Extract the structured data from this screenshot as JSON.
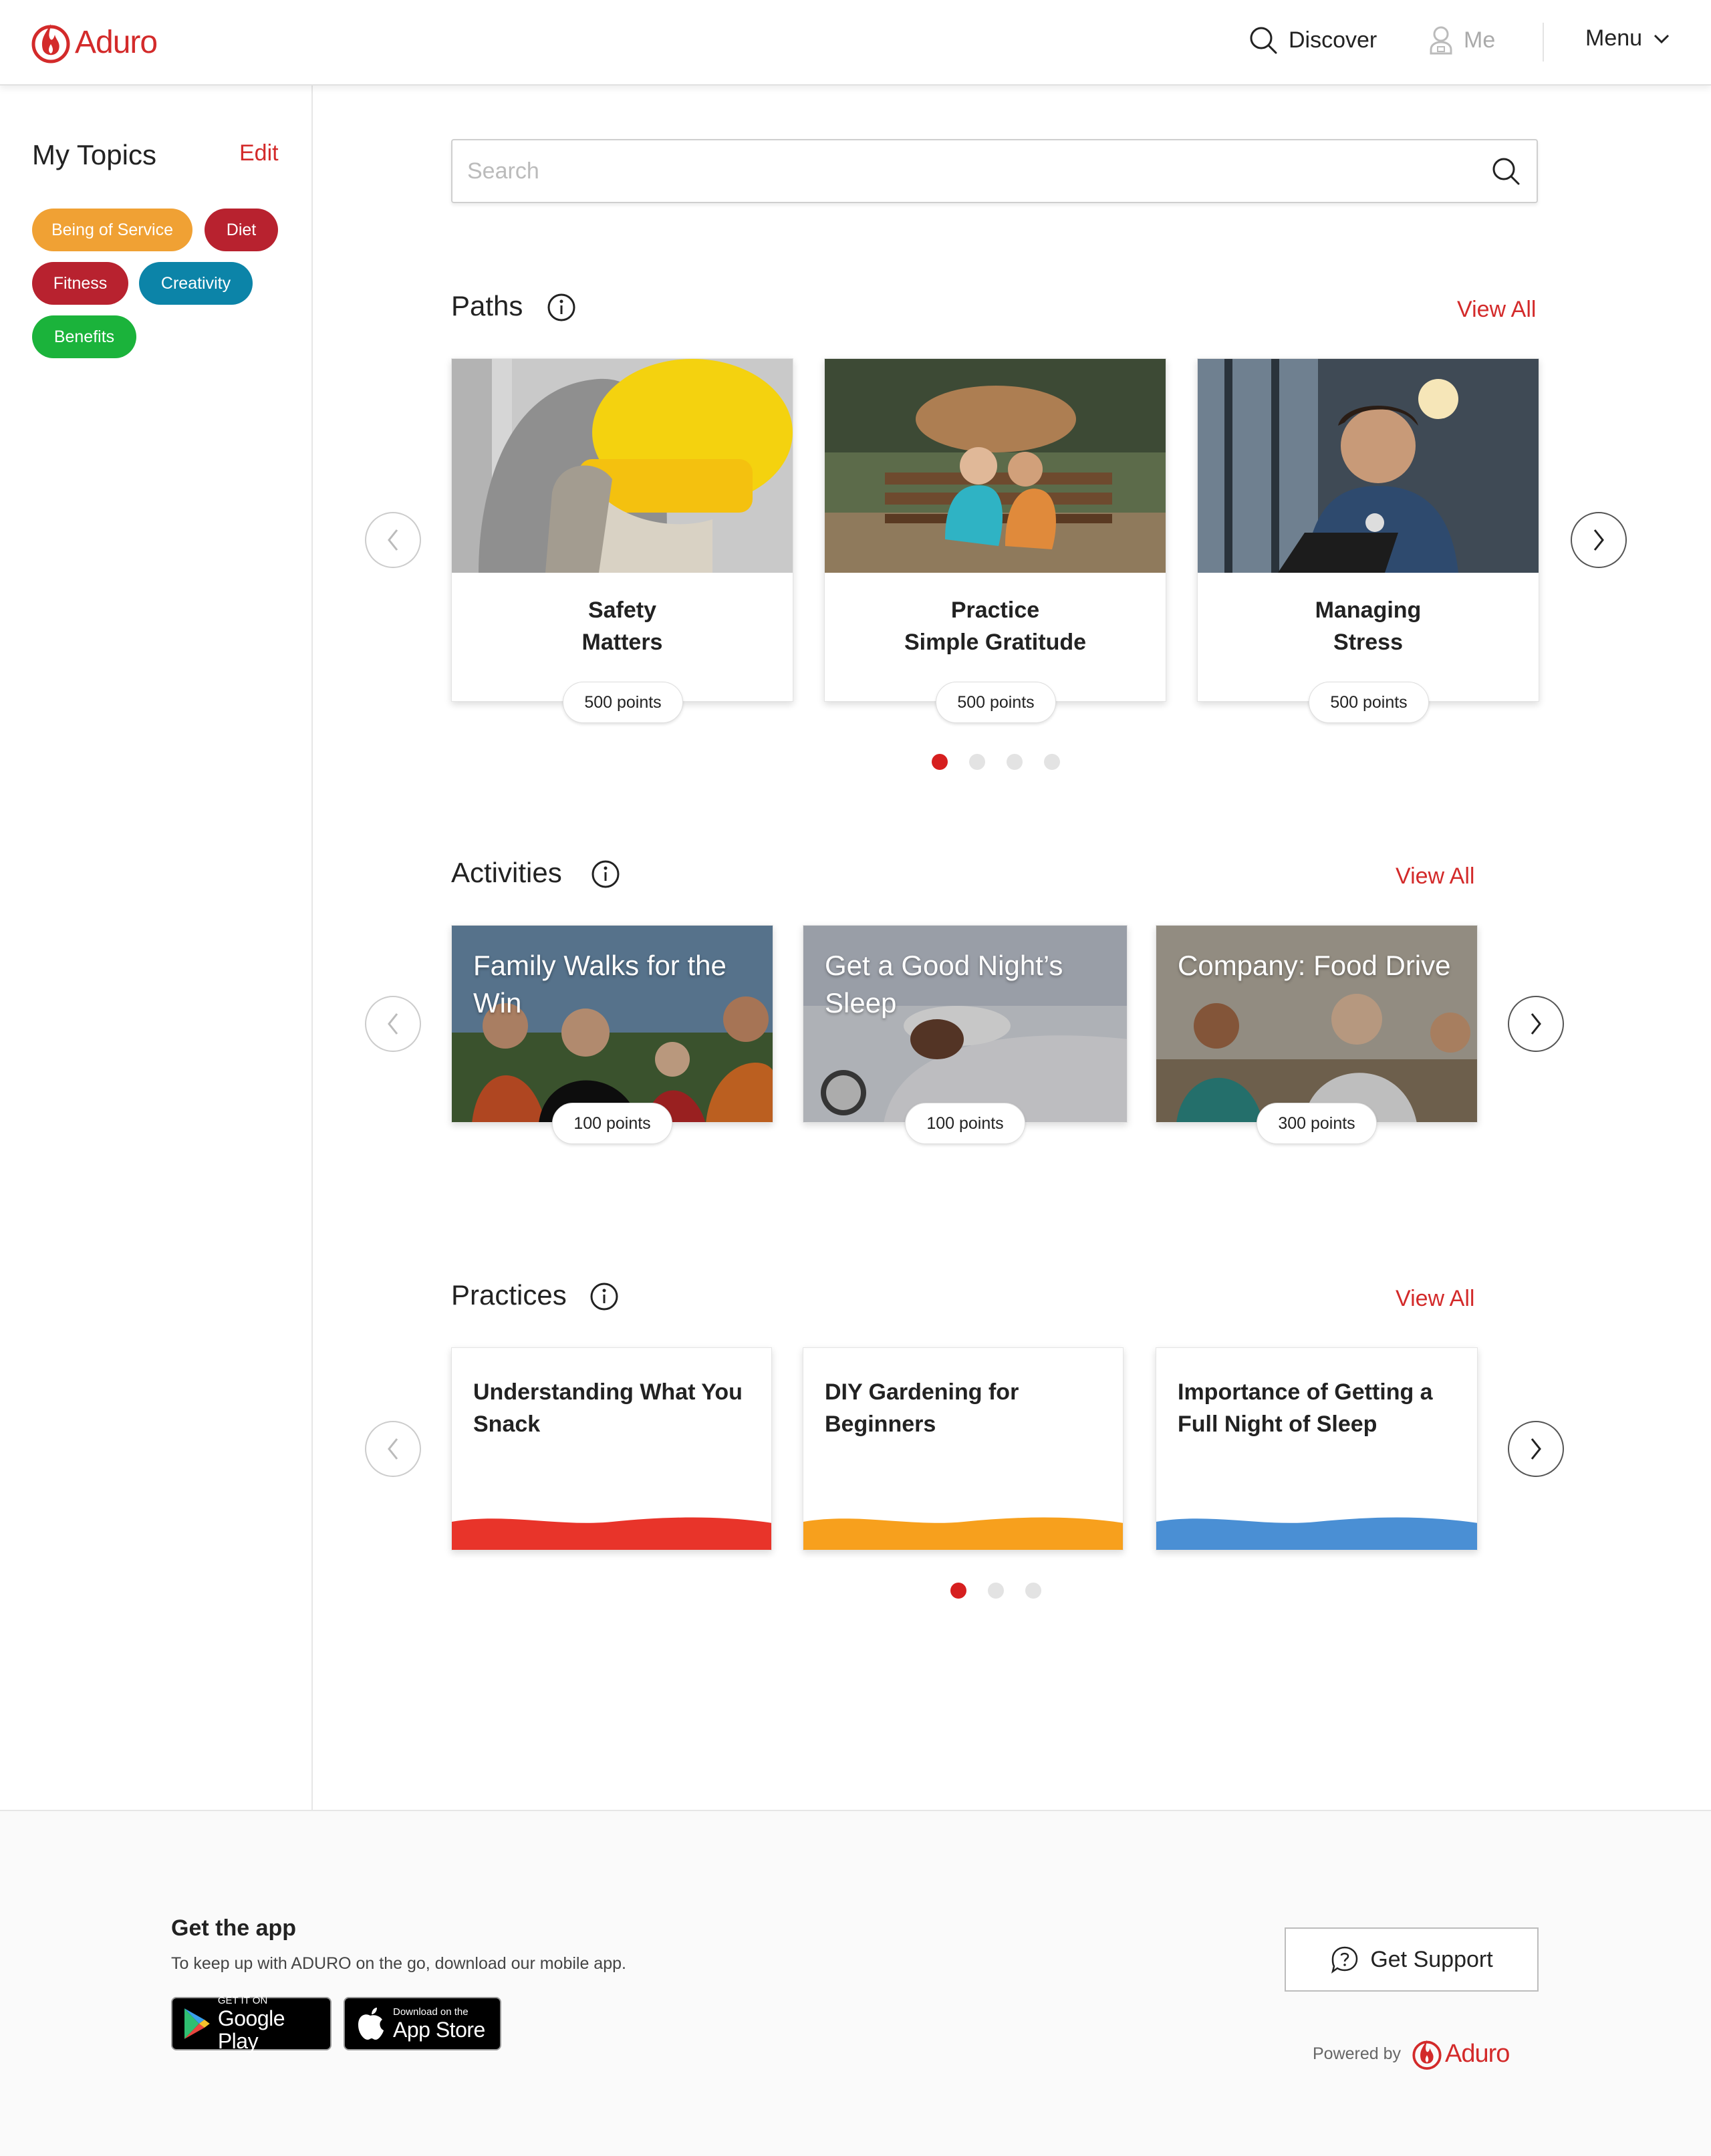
{
  "header": {
    "brand": "Aduro",
    "nav": {
      "discover": "Discover",
      "me": "Me",
      "menu": "Menu"
    }
  },
  "sidebar": {
    "title": "My Topics",
    "edit_label": "Edit",
    "topics": [
      {
        "label": "Being of Service",
        "color": "#f0a134"
      },
      {
        "label": "Diet",
        "color": "#b8222f"
      },
      {
        "label": "Fitness",
        "color": "#b8222f"
      },
      {
        "label": "Creativity",
        "color": "#0c84a8"
      },
      {
        "label": "Benefits",
        "color": "#1bb33b"
      }
    ]
  },
  "search": {
    "placeholder": "Search"
  },
  "paths": {
    "title": "Paths",
    "view_all": "View All",
    "cards": [
      {
        "title_line1": "Safety",
        "title_line2": "Matters",
        "points": "500 points"
      },
      {
        "title_line1": "Practice",
        "title_line2": "Simple Gratitude",
        "points": "500 points"
      },
      {
        "title_line1": "Managing",
        "title_line2": "Stress",
        "points": "500 points"
      }
    ],
    "pager": {
      "pages": 4,
      "active": 1
    }
  },
  "activities": {
    "title": "Activities",
    "view_all": "View All",
    "cards": [
      {
        "title": "Family Walks for the Win",
        "points": "100 points"
      },
      {
        "title": "Get a Good Night’s Sleep",
        "points": "100 points"
      },
      {
        "title": "Company: Food Drive",
        "points": "300 points"
      }
    ]
  },
  "practices": {
    "title": "Practices",
    "view_all": "View All",
    "cards": [
      {
        "title": "Understanding What You Snack",
        "wave_color": "#e8342a"
      },
      {
        "title": "DIY Gardening for Beginners",
        "wave_color": "#f7a01d"
      },
      {
        "title": "Importance of Getting a Full Night of Sleep",
        "wave_color": "#4a8fd4"
      }
    ],
    "pager": {
      "pages": 3,
      "active": 1
    }
  },
  "footer": {
    "app_title": "Get the app",
    "app_subtitle": "To keep up with ADURO on the go, download our mobile app.",
    "google_play": {
      "small": "GET IT ON",
      "big": "Google Play"
    },
    "app_store": {
      "small": "Download on the",
      "big": "App Store"
    },
    "support_label": "Get Support",
    "powered_by": "Powered by",
    "powered_brand": "Aduro"
  },
  "colors": {
    "brand_red": "#d32a2a",
    "dot_active": "#d61f1f"
  }
}
